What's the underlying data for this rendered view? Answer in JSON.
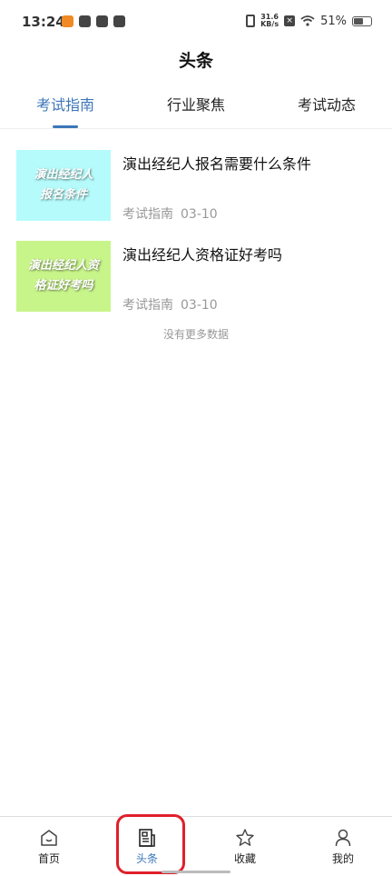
{
  "status_bar": {
    "time": "13:24",
    "net_speed_value": "31.6",
    "net_speed_unit": "KB/s",
    "battery": "51%",
    "battery_level": 0.51
  },
  "header": {
    "title": "头条"
  },
  "tabs": [
    {
      "label": "考试指南",
      "active": true
    },
    {
      "label": "行业聚焦",
      "active": false
    },
    {
      "label": "考试动态",
      "active": false
    }
  ],
  "news": [
    {
      "thumb_text_line1": "演出经纪人",
      "thumb_text_line2": "报名条件",
      "thumb_color": "#b5fbfb",
      "title": "演出经纪人报名需要什么条件",
      "category": "考试指南",
      "date": "03-10"
    },
    {
      "thumb_text_line1": "演出经纪人资",
      "thumb_text_line2": "格证好考吗",
      "thumb_color": "#c8f58a",
      "title": "演出经纪人资格证好考吗",
      "category": "考试指南",
      "date": "03-10"
    }
  ],
  "list_footer": "没有更多数据",
  "bottom_nav": [
    {
      "label": "首页",
      "icon": "home-icon",
      "active": false
    },
    {
      "label": "头条",
      "icon": "news-icon",
      "active": true
    },
    {
      "label": "收藏",
      "icon": "star-icon",
      "active": false
    },
    {
      "label": "我的",
      "icon": "profile-icon",
      "active": false
    }
  ],
  "colors": {
    "accent": "#3c76b8",
    "highlight": "#e0202a"
  }
}
